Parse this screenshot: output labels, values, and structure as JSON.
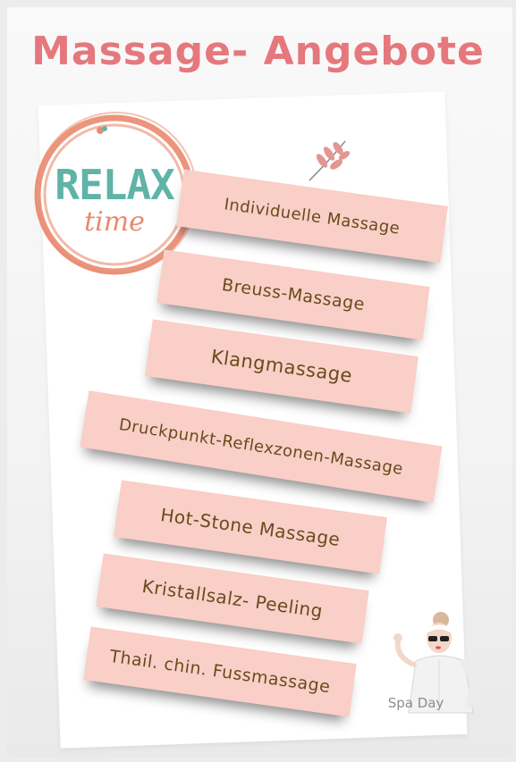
{
  "title": "Massage- Angebote",
  "logo": {
    "word": "RELAX",
    "script": "time"
  },
  "menu": {
    "items": [
      "Individuelle Massage",
      "Breuss-Massage",
      "Klangmassage",
      "Druckpunkt-Reflexzonen-Massage",
      "Hot-Stone Massage",
      "Kristallsalz- Peeling",
      "Thail. chin. Fussmassage"
    ]
  },
  "illustration": {
    "caption": "Spa Day"
  },
  "colors": {
    "title": "#e5787d",
    "card_bg": "#f9cfc8",
    "card_text": "#6b4a1c",
    "logo_teal": "#5fb3a7",
    "logo_coral": "#e98a6e"
  },
  "icons": [
    "relax-logo",
    "sprig-icon",
    "spa-day-illustration"
  ]
}
